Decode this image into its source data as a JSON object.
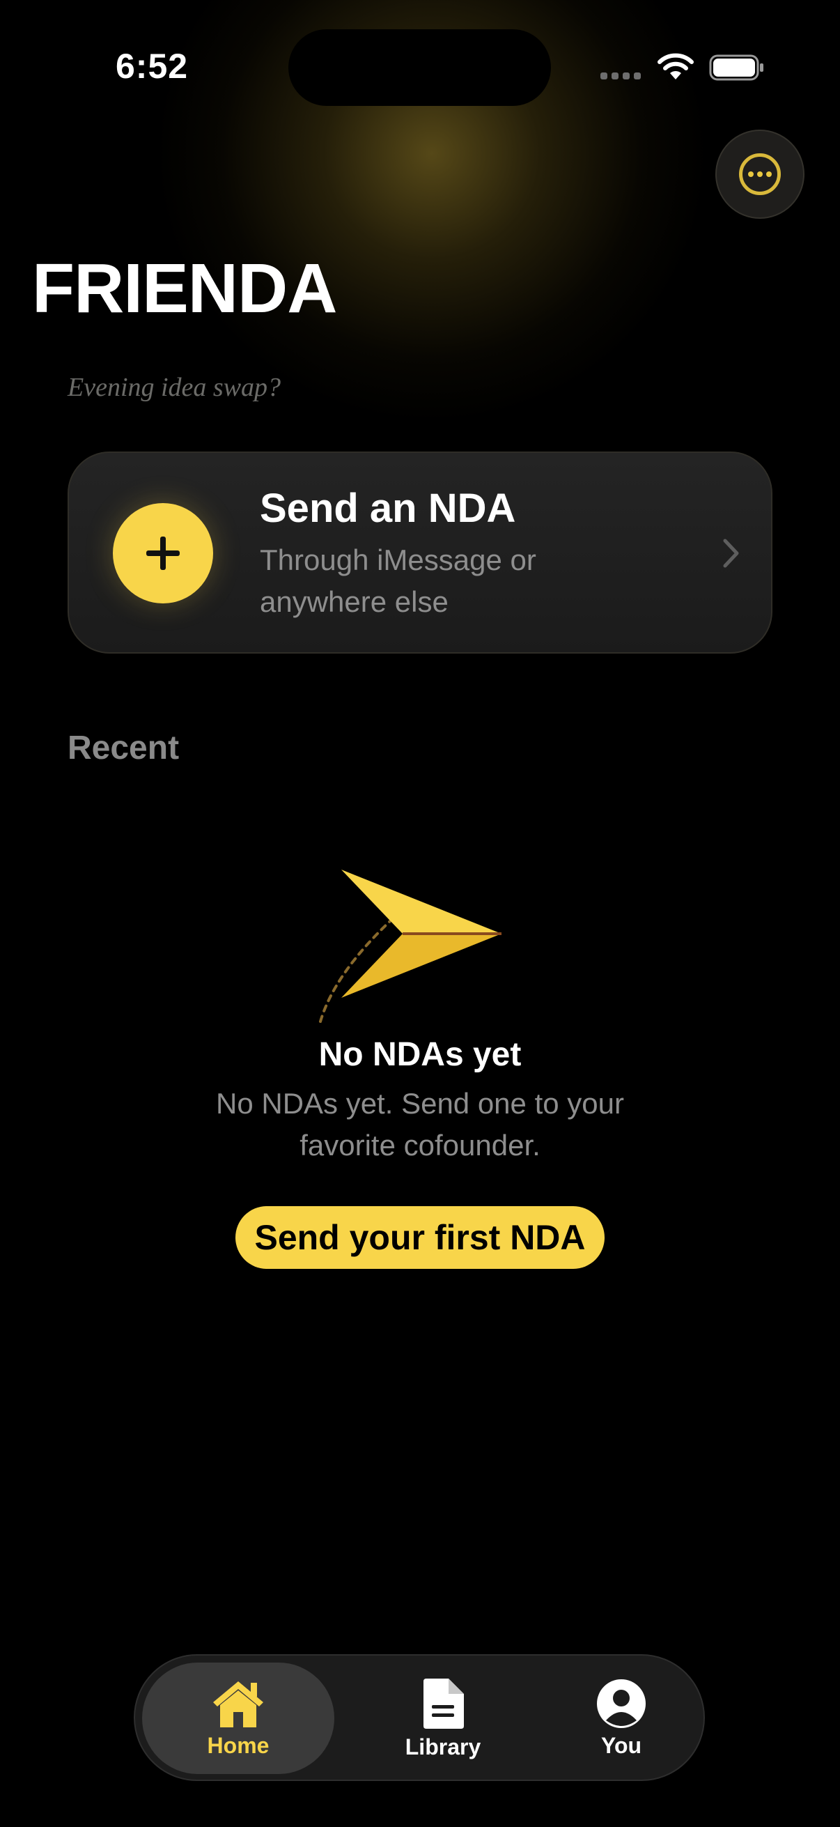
{
  "status_bar": {
    "time": "6:52"
  },
  "header": {
    "title": "FRIENDA",
    "tagline": "Evening idea swap?"
  },
  "send_card": {
    "title": "Send an NDA",
    "subtitle": "Through iMessage or anywhere else"
  },
  "recent": {
    "label": "Recent"
  },
  "empty_state": {
    "title": "No NDAs yet",
    "text": "No NDAs yet. Send one to your favorite cofounder.",
    "button_label": "Send your first NDA"
  },
  "tabs": [
    {
      "label": "Home",
      "icon": "house-icon",
      "selected": true
    },
    {
      "label": "Library",
      "icon": "document-icon",
      "selected": false
    },
    {
      "label": "You",
      "icon": "person-icon",
      "selected": false
    }
  ],
  "colors": {
    "accent": "#f8d54a",
    "background": "#000000",
    "card": "#1e1e1e",
    "muted_text": "#8e8e8e"
  }
}
